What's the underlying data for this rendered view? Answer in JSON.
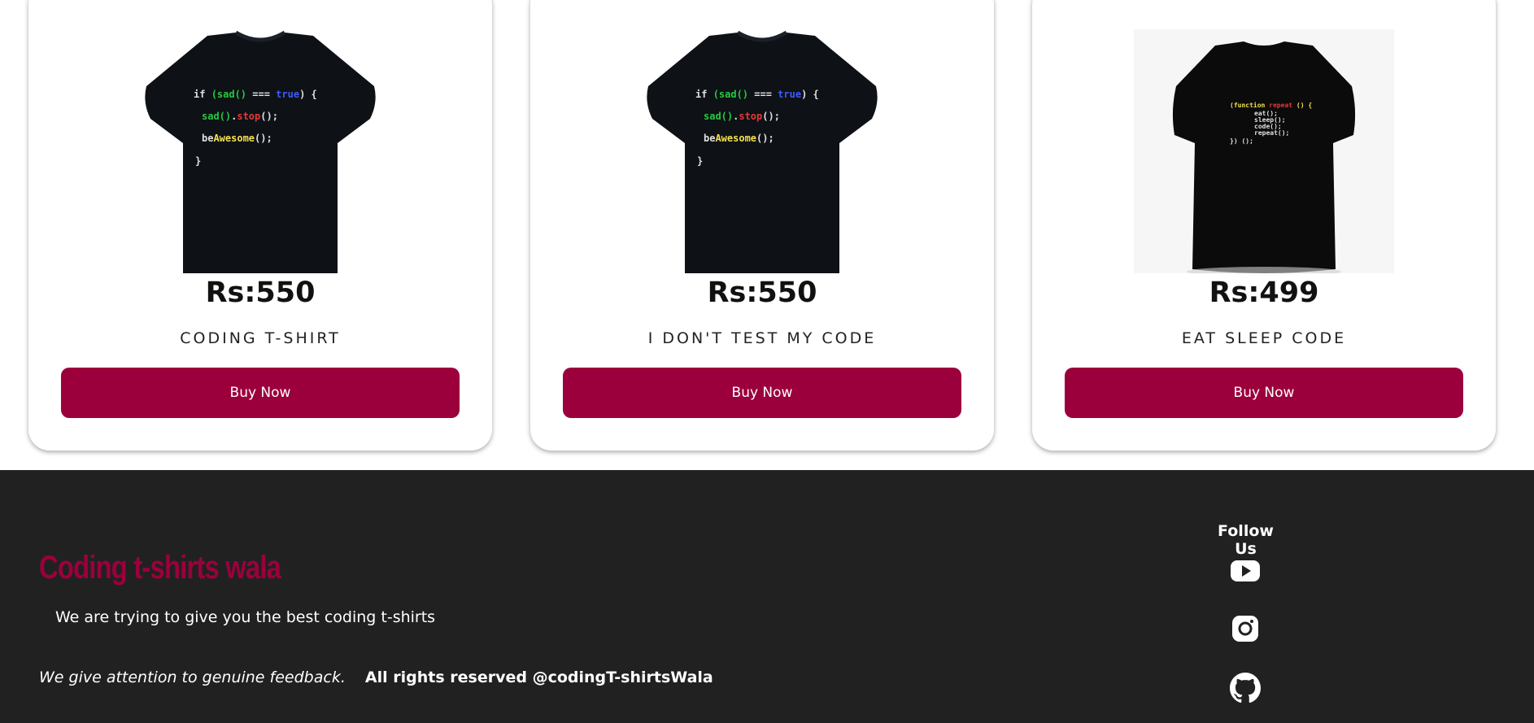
{
  "products": [
    {
      "price": "Rs:550",
      "name": "CODING T-SHIRT",
      "buy_label": "Buy Now",
      "shirt_code": [
        "if  (sad() === true) {",
        "sad().stop();",
        "beAwesome();",
        "}"
      ]
    },
    {
      "price": "Rs:550",
      "name": "I DON'T TEST MY CODE",
      "buy_label": "Buy Now",
      "shirt_code": [
        "if  (sad() === true) {",
        "sad().stop();",
        "beAwesome();",
        "}"
      ]
    },
    {
      "price": "Rs:499",
      "name": "EAT SLEEP CODE",
      "buy_label": "Buy Now",
      "shirt_code": [
        "(function repeat () {",
        "eat();",
        "sleep();",
        "code();",
        "repeat();",
        "}) ();"
      ]
    }
  ],
  "footer": {
    "brand": "Coding t-shirts wala",
    "tagline": "We are trying to give you the best coding t-shirts",
    "feedback": "We give attention to genuine feedback.",
    "rights": "All rights reserved @codingT-shirtsWala",
    "follow_title": "Follow Us",
    "social_icons": [
      "youtube-icon",
      "instagram-icon",
      "github-icon"
    ]
  },
  "colors": {
    "accent": "#9b003c",
    "footer_bg": "#212121",
    "code_white": "#e0e0e0",
    "code_green": "#27c93f",
    "code_blue": "#3d5afe",
    "code_red": "#e53935",
    "code_yellow": "#f4e04d"
  }
}
